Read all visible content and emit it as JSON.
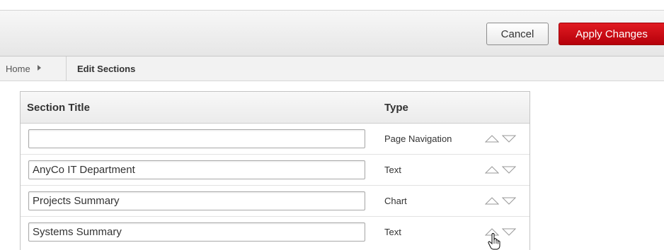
{
  "toolbar": {
    "cancel_label": "Cancel",
    "apply_label": "Apply Changes"
  },
  "breadcrumb": {
    "home": "Home",
    "current": "Edit Sections"
  },
  "grid": {
    "columns": [
      "Section Title",
      "Type"
    ],
    "rows": [
      {
        "title": "",
        "type": "Page Navigation"
      },
      {
        "title": "AnyCo IT Department",
        "type": "Text"
      },
      {
        "title": "Projects Summary",
        "type": "Chart"
      },
      {
        "title": "Systems Summary",
        "type": "Text"
      }
    ]
  },
  "colors": {
    "apply_button": "#cc0a12",
    "toolbar_bg": "#ececec",
    "arrow_stroke": "#9a9a9a"
  },
  "icons": {
    "move_up": "triangle-up-icon",
    "move_down": "triangle-down-icon",
    "breadcrumb_separator": "caret-right-icon",
    "pointer": "hand-pointer-icon"
  }
}
